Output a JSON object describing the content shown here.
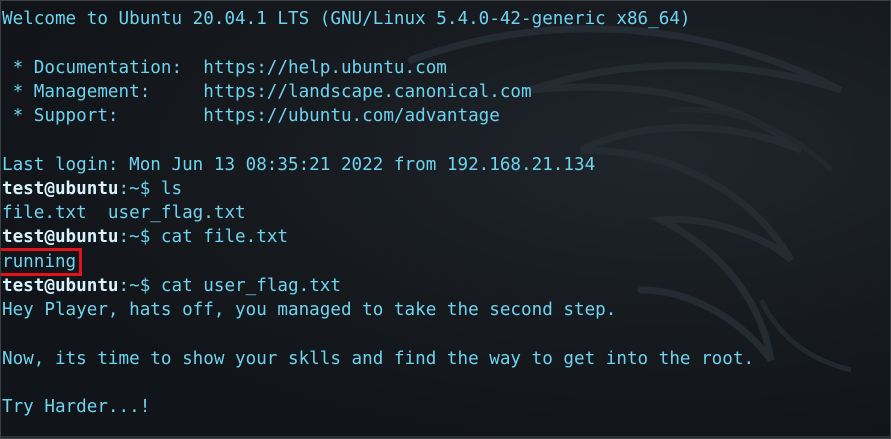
{
  "terminal": {
    "top_partial": "Welcome to Ubuntu 20.04.1 LTS (GNU/Linux 5.4.0-42-generic x86_64)",
    "docs_label": " * Documentation:  https://help.ubuntu.com",
    "mgmt_label": " * Management:     https://landscape.canonical.com",
    "support_label": " * Support:        https://ubuntu.com/advantage",
    "last_login": "Last login: Mon Jun 13 08:35:21 2022 from 192.168.21.134",
    "prompt_user": "test@ubuntu",
    "prompt_path": ":~$ ",
    "cmd1": "ls",
    "ls_output": "file.txt  user_flag.txt",
    "cmd2": "cat file.txt",
    "file_output": "running",
    "cmd3": "cat user_flag.txt",
    "flag_line1": "Hey Player, hats off, you managed to take the second step.",
    "flag_line2": "Now, its time to show your sklls and find the way to get into the root.",
    "flag_line3": "Try Harder...!"
  },
  "colors": {
    "background": "#111418",
    "text": "#6fd3ef",
    "prompt_user": "#d8f4ff",
    "highlight_box": "#e3121b"
  }
}
